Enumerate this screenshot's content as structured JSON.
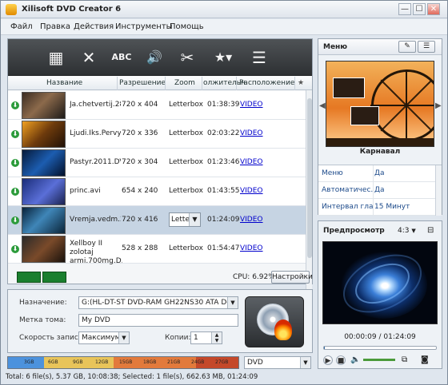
{
  "app": {
    "title": "Xilisoft DVD Creator 6"
  },
  "window_controls": {
    "minimize": "—",
    "maximize": "☐",
    "close": "✕"
  },
  "menu": [
    "Файл",
    "Правка",
    "Действия",
    "Инструменты",
    "Помощь"
  ],
  "toolbar": [
    {
      "name": "add-video-icon",
      "glyph": "▦"
    },
    {
      "name": "remove-icon",
      "glyph": "✕"
    },
    {
      "name": "subtitle-icon",
      "glyph": "ABC"
    },
    {
      "name": "audio-icon",
      "glyph": "🔊"
    },
    {
      "name": "cut-icon",
      "glyph": "✂"
    },
    {
      "name": "effects-icon",
      "glyph": "★▾"
    },
    {
      "name": "chapters-icon",
      "glyph": "☰"
    }
  ],
  "columns": {
    "name": "Название",
    "resolution": "Разрешение",
    "zoom": "Zoom",
    "duration": "олжительн",
    "location": "Расположение"
  },
  "rows": [
    {
      "name": "Ja.chetvertij.28...",
      "name2": "",
      "resolution": "720 x 404",
      "zoom": "Letterbox",
      "duration": "01:38:39",
      "location": "VIDEO",
      "selected": false
    },
    {
      "name": "Ljudi.Iks.Pervyj...",
      "name2": "",
      "resolution": "720 x 336",
      "zoom": "Letterbox",
      "duration": "02:03:22",
      "location": "VIDEO",
      "selected": false
    },
    {
      "name": "Pastyr.2011.DV...",
      "name2": "",
      "resolution": "720 x 304",
      "zoom": "Letterbox",
      "duration": "01:23:46",
      "location": "VIDEO",
      "selected": false
    },
    {
      "name": "princ.avi",
      "name2": "",
      "resolution": "654 x 240",
      "zoom": "Letterbox",
      "duration": "01:43:55",
      "location": "VIDEO",
      "selected": false
    },
    {
      "name": "Vremja.vedm.2...",
      "name2": "",
      "resolution": "720 x 416",
      "zoom": "Lette",
      "duration": "01:24:09",
      "location": "VIDEO",
      "selected": true
    },
    {
      "name": "Xellboy II zolotaj",
      "name2": "armi.700mg.D...",
      "resolution": "528 x 288",
      "zoom": "Letterbox",
      "duration": "01:54:47",
      "location": "VIDEO",
      "selected": false
    }
  ],
  "status_strip": {
    "cpu": "CPU: 6.92%",
    "settings_label": "Настройки"
  },
  "destination": {
    "target_label": "Назначение:",
    "target_value": "G:(HL-DT-ST DVD-RAM GH22NS30 ATA Device)",
    "volume_label": "Метка тома:",
    "volume_value": "My DVD",
    "speed_label": "Скорость записи:",
    "speed_value": "Максимум",
    "copies_label": "Копии:",
    "copies_value": "1"
  },
  "capacity": {
    "used_fraction": 0.62,
    "ticks": [
      "3GB",
      "6GB",
      "9GB",
      "12GB",
      "15GB",
      "18GB",
      "21GB",
      "24GB",
      "27GB"
    ],
    "disc_type": "DVD"
  },
  "status_bar": "Total: 6 file(s), 5.37 GB, 10:08:38; Selected: 1 file(s), 662.63 MB, 01:24:09",
  "menu_panel": {
    "title": "Меню",
    "caption": "Карнавал",
    "properties": [
      {
        "key": "Меню",
        "value": "Да"
      },
      {
        "key": "Автоматичес...",
        "value": "Да"
      },
      {
        "key": "Интервал глав",
        "value": "15 Минут"
      }
    ]
  },
  "preview_panel": {
    "title": "Предпросмотр",
    "aspect": "4:3",
    "time": "00:00:09 / 01:24:09",
    "playback_progress": 0.002
  }
}
